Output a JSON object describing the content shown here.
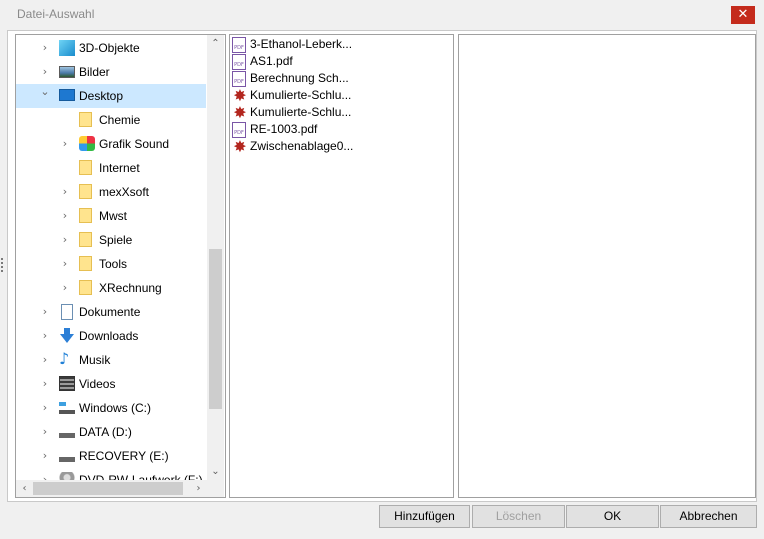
{
  "window": {
    "title": "Datei-Auswahl",
    "close_glyph": "✕"
  },
  "tree": {
    "items": [
      {
        "label": "3D-Objekte",
        "icon": "3d-objects-icon",
        "chevron": "›",
        "level": 0
      },
      {
        "label": "Bilder",
        "icon": "pictures-icon",
        "chevron": "›",
        "level": 0
      },
      {
        "label": "Desktop",
        "icon": "desktop-icon",
        "chevron": "⌄",
        "level": 0,
        "selected": true
      },
      {
        "label": "Chemie",
        "icon": "folder-icon",
        "chevron": "",
        "level": 1
      },
      {
        "label": "Grafik Sound",
        "icon": "grafik-sound-icon",
        "chevron": "›",
        "level": 1
      },
      {
        "label": "Internet",
        "icon": "folder-icon",
        "chevron": "",
        "level": 1
      },
      {
        "label": "mexXsoft",
        "icon": "folder-icon",
        "chevron": "›",
        "level": 1
      },
      {
        "label": "Mwst",
        "icon": "folder-icon",
        "chevron": "›",
        "level": 1
      },
      {
        "label": "Spiele",
        "icon": "folder-icon",
        "chevron": "›",
        "level": 1
      },
      {
        "label": "Tools",
        "icon": "folder-icon",
        "chevron": "›",
        "level": 1
      },
      {
        "label": "XRechnung",
        "icon": "folder-icon",
        "chevron": "›",
        "level": 1
      },
      {
        "label": "Dokumente",
        "icon": "documents-icon",
        "chevron": "›",
        "level": 0
      },
      {
        "label": "Downloads",
        "icon": "downloads-icon",
        "chevron": "›",
        "level": 0
      },
      {
        "label": "Musik",
        "icon": "music-icon",
        "chevron": "›",
        "level": 0
      },
      {
        "label": "Videos",
        "icon": "videos-icon",
        "chevron": "›",
        "level": 0
      },
      {
        "label": "Windows (C:)",
        "icon": "windows-drive-icon",
        "chevron": "›",
        "level": 0
      },
      {
        "label": "DATA (D:)",
        "icon": "drive-icon",
        "chevron": "›",
        "level": 0
      },
      {
        "label": "RECOVERY (E:)",
        "icon": "drive-icon",
        "chevron": "›",
        "level": 0
      },
      {
        "label": "DVD-RW-Laufwerk (F:)",
        "icon": "dvd-drive-icon",
        "chevron": "›",
        "level": 0
      }
    ],
    "scroll_up": "⌃",
    "scroll_down": "⌄",
    "scroll_left": "‹",
    "scroll_right": "›"
  },
  "files": [
    {
      "label": "3-Ethanol-Leberk...",
      "icon": "pdf-icon"
    },
    {
      "label": "AS1.pdf",
      "icon": "pdf-icon"
    },
    {
      "label": "Berechnung Sch...",
      "icon": "pdf-icon"
    },
    {
      "label": "Kumulierte-Schlu...",
      "icon": "snapshot-icon"
    },
    {
      "label": "Kumulierte-Schlu...",
      "icon": "snapshot-icon"
    },
    {
      "label": "RE-1003.pdf",
      "icon": "pdf-icon"
    },
    {
      "label": "Zwischenablage0...",
      "icon": "snapshot-icon"
    }
  ],
  "pdf_icon_text": "PDF",
  "buttons": {
    "add": "Hinzufügen",
    "delete": "Löschen",
    "ok": "OK",
    "cancel": "Abbrechen"
  },
  "colors": {
    "selection": "#cce8ff",
    "close": "#c42b1c",
    "folder": "#ffe48e"
  }
}
